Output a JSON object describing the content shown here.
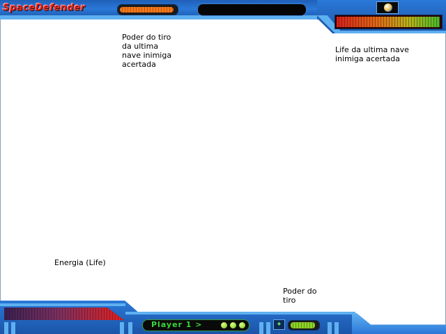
{
  "game": {
    "logo": "SpaceDefender"
  },
  "hud": {
    "top_shot_power_level": 0.96,
    "enemy_life_level": 0.99,
    "player_life_level": 1.0,
    "player_label": "Player 1  >",
    "bottom_shot_power_level": 0.92,
    "colors": {
      "hud_blue": "#2a78d8",
      "hud_light": "#5fb0f0",
      "player_text": "#38d838",
      "logo_red": "#e8231e"
    }
  },
  "icons": {
    "target": "planet-orb-icon",
    "weapon": "weapon-icon"
  },
  "annotations": {
    "top_shot_power": "Poder do tiro\nda ultima\nnave inimiga\nacertada",
    "enemy_life": "Life da ultima nave\ninimiga acertada",
    "player_energy": "Energia (Life)",
    "player_shot_power": "Poder do\ntiro"
  }
}
